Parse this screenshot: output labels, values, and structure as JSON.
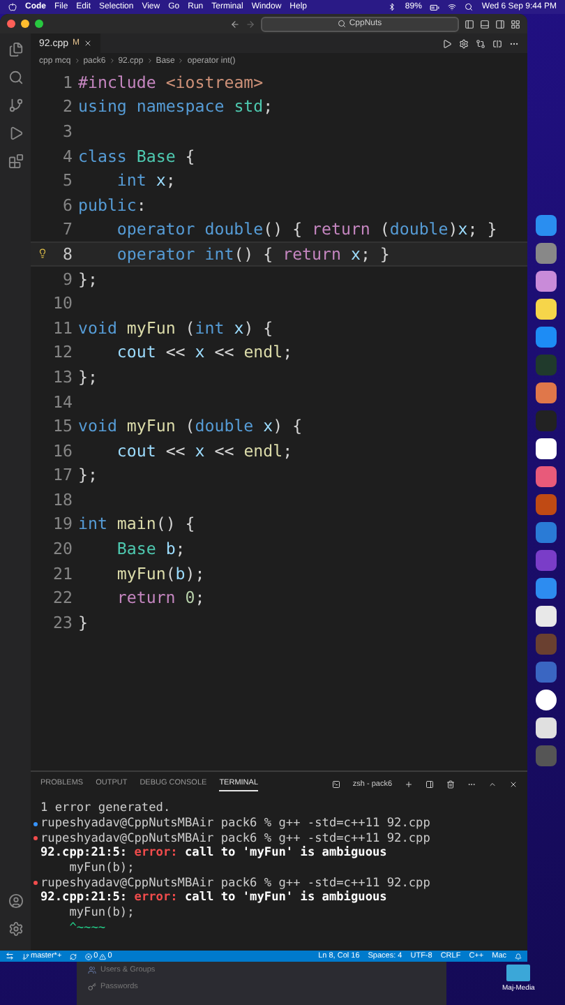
{
  "menu_bar": {
    "app": "Code",
    "items": [
      "File",
      "Edit",
      "Selection",
      "View",
      "Go",
      "Run",
      "Terminal",
      "Window",
      "Help"
    ],
    "battery": "89%",
    "clock": "Wed 6 Sep  9:44 PM"
  },
  "title_bar": {
    "search": "CppNuts"
  },
  "tabs": [
    {
      "label": "92.cpp",
      "badge": "M",
      "selected": true
    }
  ],
  "breadcrumb": [
    "cpp mcq",
    "pack6",
    "92.cpp",
    "Base",
    "operator int()"
  ],
  "editor": {
    "lines": [
      {
        "number": "1",
        "current": false,
        "indent": false,
        "tokens": [
          {
            "kind": "ctl",
            "text": "#include "
          },
          {
            "kind": "str",
            "text": "<iostream>"
          }
        ]
      },
      {
        "number": "2",
        "current": false,
        "indent": false,
        "tokens": [
          {
            "kind": "kw",
            "text": "using "
          },
          {
            "kind": "kw",
            "text": "namespace "
          },
          {
            "kind": "type",
            "text": "std"
          },
          {
            "kind": "plain",
            "text": ";"
          }
        ]
      },
      {
        "number": "3",
        "current": false
      },
      {
        "number": "4",
        "current": false,
        "indent": false,
        "tokens": [
          {
            "kind": "kw",
            "text": "class "
          },
          {
            "kind": "type",
            "text": "Base "
          },
          {
            "kind": "plain",
            "text": "{"
          }
        ]
      },
      {
        "number": "5",
        "current": false,
        "indent": true,
        "tokens": [
          {
            "kind": "kw",
            "text": "int "
          },
          {
            "kind": "var",
            "text": "x"
          },
          {
            "kind": "plain",
            "text": ";"
          }
        ]
      },
      {
        "number": "6",
        "current": false,
        "indent": false,
        "tokens": [
          {
            "kind": "kw",
            "text": "public"
          },
          {
            "kind": "plain",
            "text": ":"
          }
        ]
      },
      {
        "number": "7",
        "current": false,
        "indent": true,
        "tokens": [
          {
            "kind": "kw",
            "text": "operator "
          },
          {
            "kind": "kw",
            "text": "double"
          },
          {
            "kind": "plain",
            "text": "() { "
          },
          {
            "kind": "ctl",
            "text": "return "
          },
          {
            "kind": "plain",
            "text": "("
          },
          {
            "kind": "kw",
            "text": "double"
          },
          {
            "kind": "plain",
            "text": ")"
          },
          {
            "kind": "var",
            "text": "x"
          },
          {
            "kind": "plain",
            "text": "; }"
          }
        ]
      },
      {
        "number": "8",
        "current": true,
        "indent": true,
        "tokens": [
          {
            "kind": "kw",
            "text": "operator "
          },
          {
            "kind": "kw",
            "text": "int"
          },
          {
            "kind": "plain",
            "text": "() { "
          },
          {
            "kind": "ctl",
            "text": "return "
          },
          {
            "kind": "var",
            "text": "x"
          },
          {
            "kind": "plain",
            "text": "; }"
          }
        ]
      },
      {
        "number": "9",
        "current": false,
        "indent": false,
        "tokens": [
          {
            "kind": "plain",
            "text": "};"
          }
        ]
      },
      {
        "number": "10",
        "current": false
      },
      {
        "number": "11",
        "current": false,
        "indent": false,
        "tokens": [
          {
            "kind": "kw",
            "text": "void "
          },
          {
            "kind": "fn",
            "text": "myFun "
          },
          {
            "kind": "plain",
            "text": "("
          },
          {
            "kind": "kw",
            "text": "int "
          },
          {
            "kind": "var",
            "text": "x"
          },
          {
            "kind": "plain",
            "text": ") {"
          }
        ]
      },
      {
        "number": "12",
        "current": false,
        "indent": true,
        "tokens": [
          {
            "kind": "var",
            "text": "cout "
          },
          {
            "kind": "plain",
            "text": "<< "
          },
          {
            "kind": "var",
            "text": "x "
          },
          {
            "kind": "plain",
            "text": "<< "
          },
          {
            "kind": "fn",
            "text": "endl"
          },
          {
            "kind": "plain",
            "text": ";"
          }
        ]
      },
      {
        "number": "13",
        "current": false,
        "indent": false,
        "tokens": [
          {
            "kind": "plain",
            "text": "};"
          }
        ]
      },
      {
        "number": "14",
        "current": false
      },
      {
        "number": "15",
        "current": false,
        "indent": false,
        "tokens": [
          {
            "kind": "kw",
            "text": "void "
          },
          {
            "kind": "fn",
            "text": "myFun "
          },
          {
            "kind": "plain",
            "text": "("
          },
          {
            "kind": "kw",
            "text": "double "
          },
          {
            "kind": "var",
            "text": "x"
          },
          {
            "kind": "plain",
            "text": ") {"
          }
        ]
      },
      {
        "number": "16",
        "current": false,
        "indent": true,
        "tokens": [
          {
            "kind": "var",
            "text": "cout "
          },
          {
            "kind": "plain",
            "text": "<< "
          },
          {
            "kind": "var",
            "text": "x "
          },
          {
            "kind": "plain",
            "text": "<< "
          },
          {
            "kind": "fn",
            "text": "endl"
          },
          {
            "kind": "plain",
            "text": ";"
          }
        ]
      },
      {
        "number": "17",
        "current": false,
        "indent": false,
        "tokens": [
          {
            "kind": "plain",
            "text": "};"
          }
        ]
      },
      {
        "number": "18",
        "current": false
      },
      {
        "number": "19",
        "current": false,
        "indent": false,
        "tokens": [
          {
            "kind": "kw",
            "text": "int "
          },
          {
            "kind": "fn",
            "text": "main"
          },
          {
            "kind": "plain",
            "text": "() {"
          }
        ]
      },
      {
        "number": "20",
        "current": false,
        "indent": true,
        "tokens": [
          {
            "kind": "type",
            "text": "Base "
          },
          {
            "kind": "var",
            "text": "b"
          },
          {
            "kind": "plain",
            "text": ";"
          }
        ]
      },
      {
        "number": "21",
        "current": false,
        "indent": true,
        "tokens": [
          {
            "kind": "fn",
            "text": "myFun"
          },
          {
            "kind": "plain",
            "text": "("
          },
          {
            "kind": "var",
            "text": "b"
          },
          {
            "kind": "plain",
            "text": ");"
          }
        ]
      },
      {
        "number": "22",
        "current": false,
        "indent": true,
        "tokens": [
          {
            "kind": "ctl",
            "text": "return "
          },
          {
            "kind": "num",
            "text": "0"
          },
          {
            "kind": "plain",
            "text": ";"
          }
        ]
      },
      {
        "number": "23",
        "current": false,
        "indent": false,
        "tokens": [
          {
            "kind": "plain",
            "text": "}"
          }
        ]
      }
    ]
  },
  "panel": {
    "tabs": [
      {
        "label": "PROBLEMS",
        "selected": false
      },
      {
        "label": "OUTPUT",
        "selected": false
      },
      {
        "label": "DEBUG CONSOLE",
        "selected": false
      },
      {
        "label": "TERMINAL",
        "selected": true
      }
    ],
    "shell": "zsh - pack6",
    "terminal": [
      {
        "kind": "plain",
        "tokens": [
          {
            "kind": "plain",
            "text": "1 error generated."
          }
        ]
      },
      {
        "kind": "prompt",
        "failed": false,
        "tokens": [
          {
            "kind": "plain",
            "text": "rupeshyadav@CppNutsMBAir pack6 % g++ -std=c++11 92.cpp"
          }
        ]
      },
      {
        "kind": "prompt",
        "failed": true,
        "tokens": [
          {
            "kind": "plain",
            "text": "rupeshyadav@CppNutsMBAir pack6 % g++ -std=c++11 92.cpp"
          }
        ]
      },
      {
        "kind": "plain",
        "tokens": [
          {
            "kind": "bold",
            "text": "92.cpp:21:5: "
          },
          {
            "kind": "error",
            "text": "error:"
          },
          {
            "kind": "bold",
            "text": " call to 'myFun' is ambiguous"
          }
        ]
      },
      {
        "kind": "plain",
        "tokens": [
          {
            "kind": "plain",
            "text": "    myFun(b);"
          }
        ]
      },
      {
        "kind": "prompt",
        "failed": true,
        "tokens": [
          {
            "kind": "plain",
            "text": "rupeshyadav@CppNutsMBAir pack6 % g++ -std=c++11 92.cpp"
          }
        ]
      },
      {
        "kind": "plain",
        "tokens": [
          {
            "kind": "bold",
            "text": "92.cpp:21:5: "
          },
          {
            "kind": "error",
            "text": "error:"
          },
          {
            "kind": "bold",
            "text": " call to 'myFun' is ambiguous"
          }
        ]
      },
      {
        "kind": "plain",
        "tokens": [
          {
            "kind": "plain",
            "text": "    myFun(b);"
          }
        ]
      },
      {
        "kind": "plain",
        "tokens": [
          {
            "kind": "caret",
            "text": "    ^~~~~"
          }
        ]
      }
    ]
  },
  "status_bar": {
    "branch": "master*+",
    "errors": "0",
    "warnings": "0",
    "items": [
      "Ln 8, Col 16",
      "Spaces: 4",
      "UTF-8",
      "CRLF",
      "C++",
      "Mac"
    ]
  },
  "desktop": {
    "settings_items": [
      "Users & Groups",
      "Passwords"
    ],
    "folder": "Maj-Media"
  }
}
